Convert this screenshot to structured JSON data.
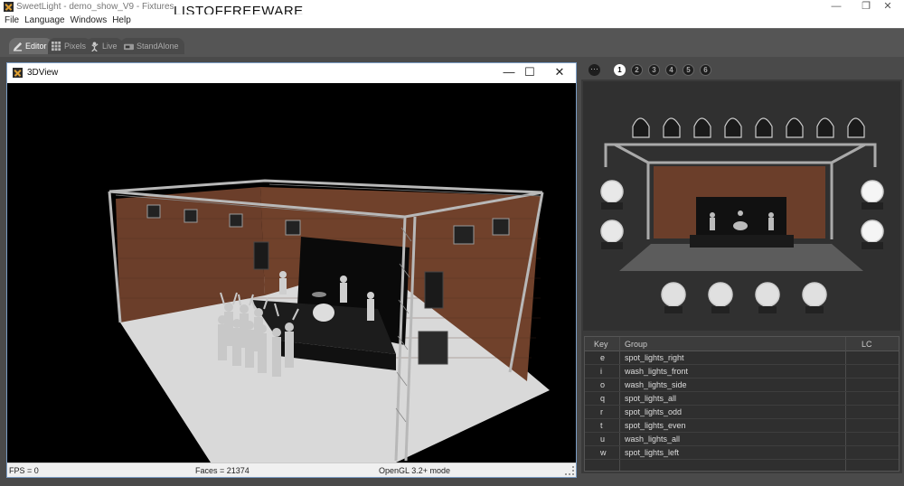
{
  "window": {
    "title": "SweetLight - demo_show_V9 - Fixtures",
    "watermark": "LISTOFFREEWARE",
    "minimize": "—",
    "restore": "❐",
    "close": "✕"
  },
  "menu": [
    "File",
    "Language",
    "Windows",
    "Help"
  ],
  "modes": [
    {
      "label": "Editor",
      "icon": "editor-icon"
    },
    {
      "label": "Pixels",
      "icon": "pixels-icon"
    },
    {
      "label": "Live",
      "icon": "live-icon"
    },
    {
      "label": "StandAlone",
      "icon": "standalone-icon"
    }
  ],
  "view3d": {
    "title": "3DView",
    "minimize": "—",
    "maximize": "☐",
    "close": "✕",
    "status": {
      "fps": "FPS = 0",
      "faces": "Faces = 21374",
      "gl": "OpenGL 3.2+ mode"
    }
  },
  "presets": {
    "menu": "···",
    "items": [
      "1",
      "2",
      "3",
      "4",
      "5",
      "6"
    ],
    "active": "1"
  },
  "groups": {
    "columns": {
      "key": "Key",
      "group": "Group",
      "lc": "LC"
    },
    "rows": [
      {
        "key": "e",
        "group": "spot_lights_right"
      },
      {
        "key": "i",
        "group": "wash_lights_front"
      },
      {
        "key": "o",
        "group": "wash_lights_side"
      },
      {
        "key": "q",
        "group": "spot_lights_all"
      },
      {
        "key": "r",
        "group": "spot_lights_odd"
      },
      {
        "key": "t",
        "group": "spot_lights_even"
      },
      {
        "key": "u",
        "group": "wash_lights_all"
      },
      {
        "key": "w",
        "group": "spot_lights_left"
      }
    ]
  },
  "colors": {
    "accent": "#7a9cc4",
    "brick": "#6b3e2a",
    "truss": "#b8b8b8"
  }
}
